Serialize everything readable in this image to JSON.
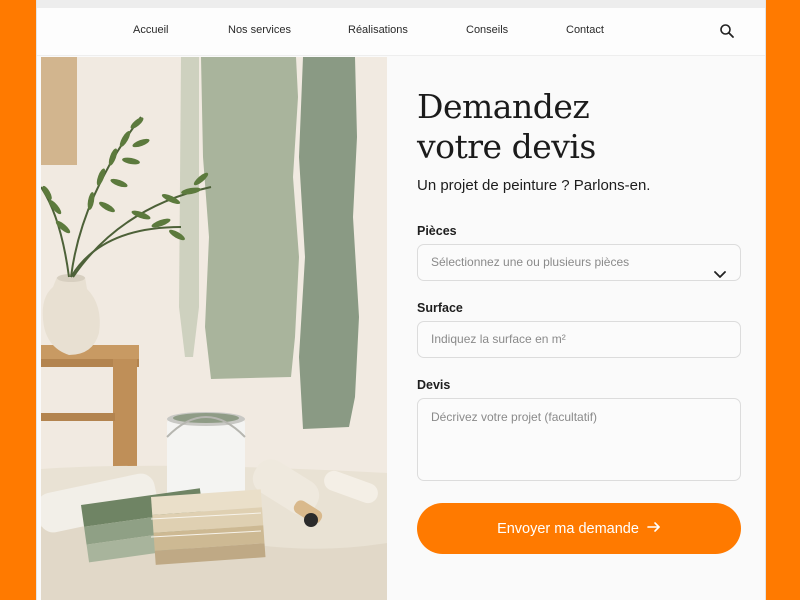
{
  "nav": {
    "items": [
      "Accueil",
      "Nos services",
      "Réalisations",
      "Conseils",
      "Contact"
    ],
    "search_icon": "search-icon"
  },
  "hero": {
    "title_line1": "Demandez",
    "title_line2": "votre devis",
    "subtitle": "Un projet de peinture ? Parlons-en."
  },
  "form": {
    "pieces": {
      "label": "Pièces",
      "placeholder": "Sélectionnez une ou plusieurs pièces",
      "icon": "chevron-down-icon"
    },
    "surface": {
      "label": "Surface",
      "placeholder": "Indiquez la surface en m²"
    },
    "devis": {
      "label": "Devis",
      "placeholder": "Décrivez votre projet (facultatif)"
    },
    "submit_label": "Envoyer ma demande",
    "submit_icon": "arrow-right-icon"
  },
  "colors": {
    "accent": "#ff7a00",
    "sage": "#8a9c84",
    "background": "#fafafa"
  }
}
